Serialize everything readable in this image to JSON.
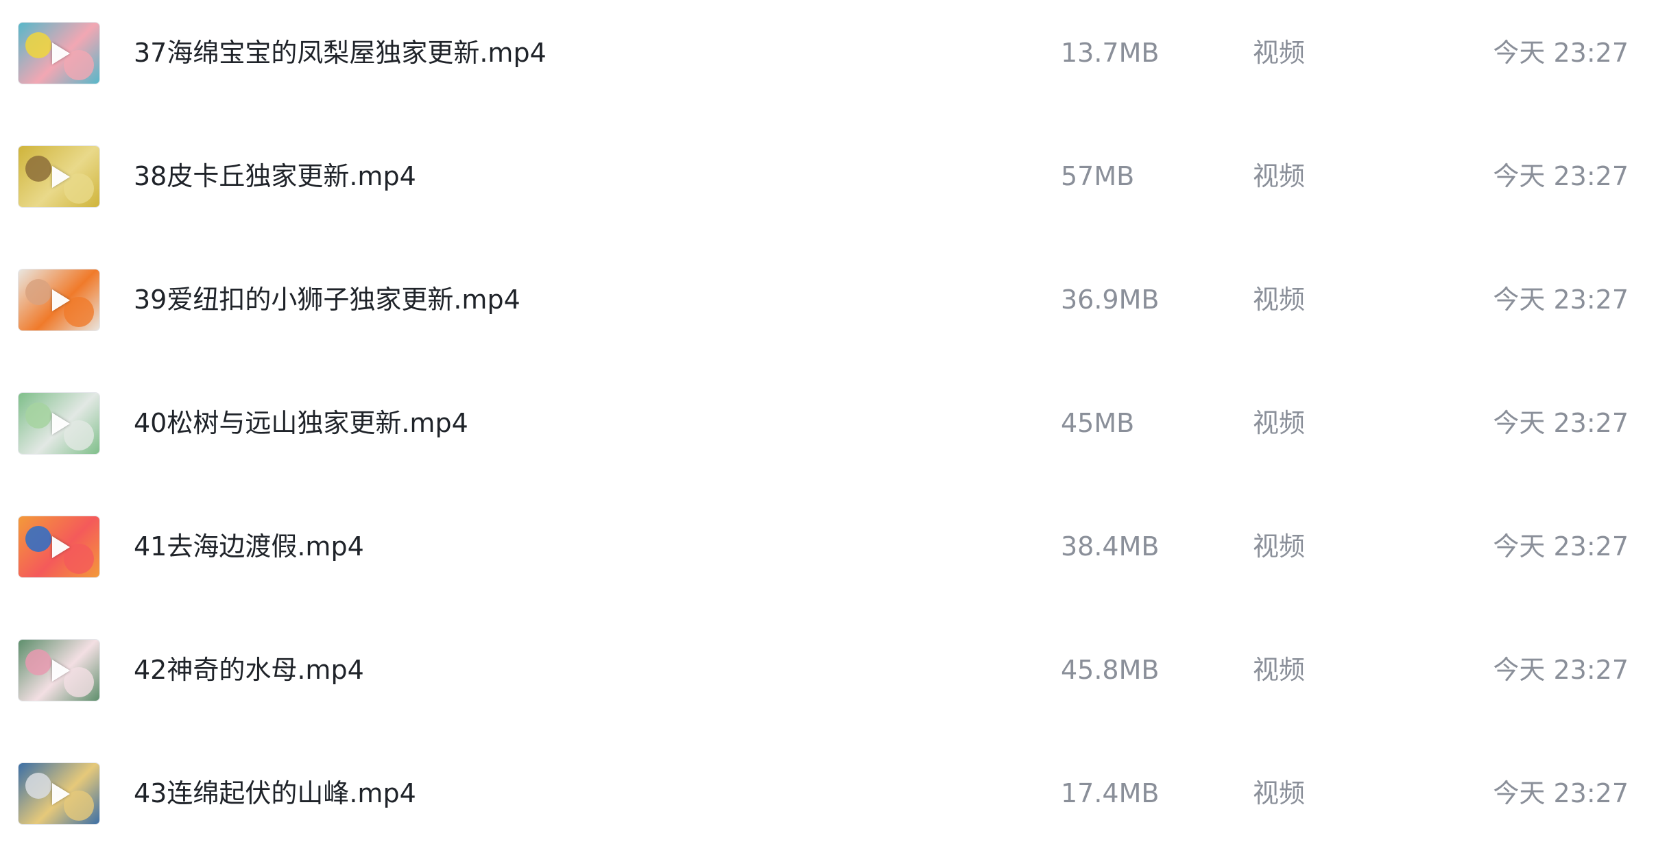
{
  "files": [
    {
      "name": "37海绵宝宝的凤梨屋独家更新.mp4",
      "size": "13.7MB",
      "type": "视频",
      "time": "今天 23:27",
      "thumb": {
        "bg": "#57b7c9",
        "a": "#f2a7b3",
        "b": "#f0d63c",
        "icon": "video-thumbnail-spongebob"
      }
    },
    {
      "name": "38皮卡丘独家更新.mp4",
      "size": "57MB",
      "type": "视频",
      "time": "今天 23:27",
      "thumb": {
        "bg": "#cfb43b",
        "a": "#e9d98a",
        "b": "#8d6f3a",
        "icon": "video-thumbnail-pikachu"
      }
    },
    {
      "name": "39爱纽扣的小狮子独家更新.mp4",
      "size": "36.9MB",
      "type": "视频",
      "time": "今天 23:27",
      "thumb": {
        "bg": "#e9e5df",
        "a": "#f07a2a",
        "b": "#d9a27f",
        "icon": "video-thumbnail-lion"
      }
    },
    {
      "name": "40松树与远山独家更新.mp4",
      "size": "45MB",
      "type": "视频",
      "time": "今天 23:27",
      "thumb": {
        "bg": "#7fbf8a",
        "a": "#e2e8e4",
        "b": "#a6d3a0",
        "icon": "video-thumbnail-pine"
      }
    },
    {
      "name": "41去海边渡假.mp4",
      "size": "38.4MB",
      "type": "视频",
      "time": "今天 23:27",
      "thumb": {
        "bg": "#f39a3a",
        "a": "#f45a5a",
        "b": "#2a6fc9",
        "icon": "video-thumbnail-beach"
      }
    },
    {
      "name": "42神奇的水母.mp4",
      "size": "45.8MB",
      "type": "视频",
      "time": "今天 23:27",
      "thumb": {
        "bg": "#5e8f6c",
        "a": "#f3dfe3",
        "b": "#e79ab0",
        "icon": "video-thumbnail-jellyfish"
      }
    },
    {
      "name": "43连绵起伏的山峰.mp4",
      "size": "17.4MB",
      "type": "视频",
      "time": "今天 23:27",
      "thumb": {
        "bg": "#3c6fa6",
        "a": "#e6c97a",
        "b": "#d9dde2",
        "icon": "video-thumbnail-mountains"
      }
    }
  ]
}
